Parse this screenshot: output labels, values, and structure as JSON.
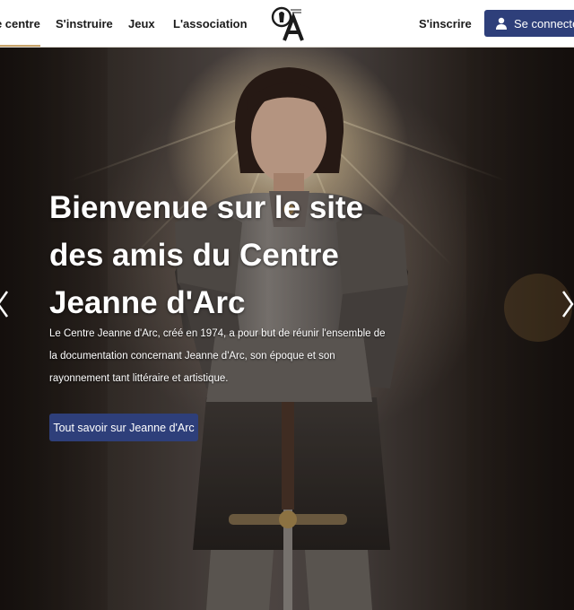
{
  "nav": {
    "items": [
      {
        "label": "Le centre",
        "active": true
      },
      {
        "label": "S'instruire"
      },
      {
        "label": "Jeux"
      },
      {
        "label": "L'association"
      }
    ],
    "register_label": "S'inscrire",
    "login_label": "Se connecter",
    "logo_icon": "cja-logo-icon"
  },
  "hero": {
    "title": "Bienvenue sur le site des amis du Centre Jeanne d'Arc",
    "description": "Le Centre Jeanne d'Arc, créé en 1974, a pour but de réunir l'ensemble de la documentation concernant Jeanne d'Arc, son époque et son rayonnement tant littéraire et artistique.",
    "cta_label": "Tout savoir sur Jeanne d'Arc",
    "prev_icon": "chevron-left-icon",
    "next_icon": "chevron-right-icon"
  },
  "colors": {
    "button": "#2e3f7a",
    "active_underline": "#c9a46a",
    "header_bg": "#ffffff"
  }
}
